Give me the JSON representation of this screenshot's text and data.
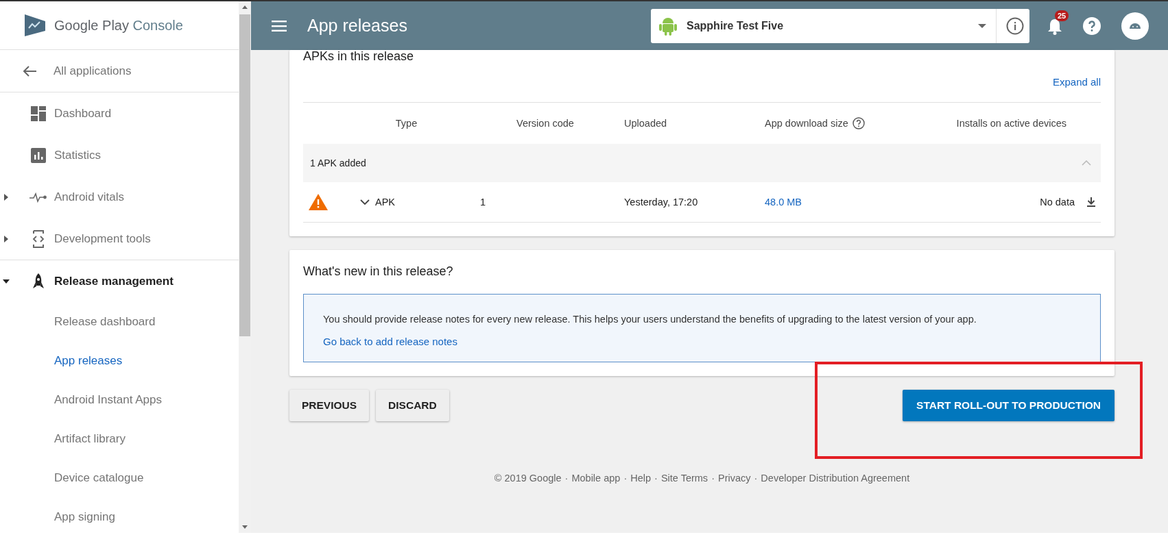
{
  "sidebar": {
    "logo": {
      "brand": "Google Play",
      "product": "Console"
    },
    "back_link": "All applications",
    "groups": [
      [
        {
          "label": "Dashboard",
          "kind": "dashboard",
          "selected": false
        },
        {
          "label": "Statistics",
          "kind": "statistics",
          "selected": false
        },
        {
          "label": "Android vitals",
          "kind": "vitals",
          "selected": false,
          "expanded": false
        },
        {
          "label": "Development tools",
          "kind": "devtools",
          "selected": false,
          "expanded": false
        }
      ],
      [
        {
          "label": "Release management",
          "kind": "release",
          "selected": true,
          "expanded": true,
          "children": [
            {
              "label": "Release dashboard",
              "selected": false
            },
            {
              "label": "App releases",
              "selected": true
            },
            {
              "label": "Android Instant Apps",
              "selected": false
            },
            {
              "label": "Artifact library",
              "selected": false
            },
            {
              "label": "Device catalogue",
              "selected": false
            },
            {
              "label": "App signing",
              "selected": false
            }
          ]
        }
      ]
    ]
  },
  "header": {
    "title": "App releases",
    "app_selector": "Sapphire Test Five",
    "notification_count": "25"
  },
  "apks_card": {
    "title": "APKs in this release",
    "expand_all": "Expand all",
    "columns": [
      "Type",
      "Version code",
      "Uploaded",
      "App download size",
      "Installs on active devices"
    ],
    "group": {
      "label": "1 APK added",
      "expanded": true
    },
    "rows": [
      {
        "warning": true,
        "expanded": false,
        "type": "APK",
        "version_code": "1",
        "uploaded": "Yesterday, 17:20",
        "size": "48.0 MB",
        "installs": "No data"
      }
    ]
  },
  "whats_new_card": {
    "title": "What's new in this release?",
    "message": "You should provide release notes for every new release. This helps your users understand the benefits of upgrading to the latest version of your app.",
    "link": "Go back to add release notes"
  },
  "buttons": {
    "left": [
      "PREVIOUS",
      "DISCARD"
    ],
    "primary": "START ROLL-OUT TO PRODUCTION"
  },
  "footer": [
    "© 2019 Google",
    "·",
    "Mobile app",
    "·",
    "Help",
    "·",
    "Site Terms",
    "·",
    "Privacy",
    "·",
    "Developer Distribution Agreement"
  ]
}
